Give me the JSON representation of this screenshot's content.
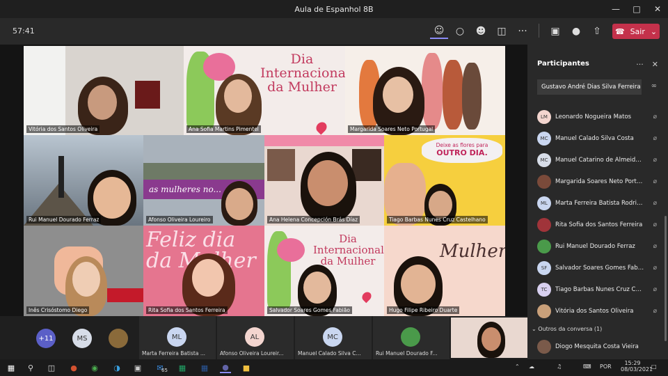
{
  "window": {
    "title": "Aula de Espanhol 8B",
    "controls": [
      "minimize-icon",
      "maximize-icon",
      "close-icon"
    ]
  },
  "toolbar": {
    "timer": "57:41",
    "icons": [
      "people-icon",
      "chat-icon",
      "reactions-icon",
      "share-tray-icon",
      "more-icon",
      "camera-icon",
      "mic-icon",
      "share-icon"
    ],
    "leave_label": "Sair",
    "leave_color": "#c4314b"
  },
  "tiles": [
    {
      "name": "Vitória dos Santos Oliveira"
    },
    {
      "name": "Ana Sofia Martins Pimentel",
      "banner": "Dia Internacional da Mulher"
    },
    {
      "name": "Margarida Soares Neto Portugal"
    },
    {
      "name": "Rui Manuel Dourado Ferraz"
    },
    {
      "name": "Afonso Oliveira Loureiro",
      "sign": "as mulheres no..."
    },
    {
      "name": "Ana Helena Concepción Brás Díaz"
    },
    {
      "name": "Tiago Barbas Nunes Cruz Castelhano",
      "poster": "Deixe as flores para",
      "poster2": "OUTRO DIA."
    },
    {
      "name": "Inês Crisóstomo Diego"
    },
    {
      "name": "Rita Sofia dos Santos Ferreira",
      "script": "Feliz dia da Mulher"
    },
    {
      "name": "Salvador Soares Gomes Fabião",
      "banner": "Dia Internacional da Mulher"
    },
    {
      "name": "Hugo Filipe Ribeiro Duarte",
      "script": "Mulher"
    }
  ],
  "bottom_bar": {
    "overflow": "+11",
    "avatars": [
      {
        "initials": "MS",
        "color": "#d7dde8"
      },
      {
        "initials": "",
        "color": "#8a6a3a"
      }
    ],
    "strips": [
      {
        "initials": "ML",
        "label": "Marta Ferreira Batista ...",
        "color": "#c9d6f0"
      },
      {
        "initials": "AL",
        "label": "Afonso Oliveira Loureir...",
        "color": "#f3d5cf"
      },
      {
        "initials": "MC",
        "label": "Manuel Calado Silva C...",
        "color": "#c9d6f0"
      },
      {
        "initials": "",
        "label": "Rui Manuel Dourado F...",
        "color": "#4a9a4a"
      }
    ]
  },
  "panel": {
    "title": "Participantes",
    "search_value": "Gustavo André Dias Silva Ferreira",
    "participants": [
      {
        "initials": "LM",
        "name": "Leonardo Nogueira Matos",
        "color": "#f3d5cf"
      },
      {
        "initials": "MC",
        "name": "Manuel Calado Silva Costa",
        "color": "#c9d6f0"
      },
      {
        "initials": "MC",
        "name": "Manuel Catarino de Almeida ...",
        "color": "#d7dde8"
      },
      {
        "initials": "",
        "name": "Margarida Soares Neto Portu...",
        "color": "#7a4a3a"
      },
      {
        "initials": "ML",
        "name": "Marta Ferreira Batista Rodrigu...",
        "color": "#c9d6f0"
      },
      {
        "initials": "",
        "name": "Rita Sofia dos Santos Ferreira",
        "color": "#a0343a"
      },
      {
        "initials": "",
        "name": "Rui Manuel Dourado Ferraz",
        "color": "#4a9a4a"
      },
      {
        "initials": "SF",
        "name": "Salvador Soares Gomes Fabião",
        "color": "#c9d6f0"
      },
      {
        "initials": "TC",
        "name": "Tiago Barbas Nunes Cruz Cas...",
        "color": "#d8d0f0"
      },
      {
        "initials": "",
        "name": "Vitória dos Santos Oliveira",
        "color": "#c9a07a"
      }
    ],
    "section_label": "Outros da conversa (1)",
    "others": [
      {
        "initials": "",
        "name": "Diogo Mesquita Costa Vieira",
        "color": "#7a5a4a"
      }
    ]
  },
  "taskbar": {
    "lang": "POR",
    "time": "15:29",
    "date": "08/03/2021",
    "badge": "65"
  }
}
